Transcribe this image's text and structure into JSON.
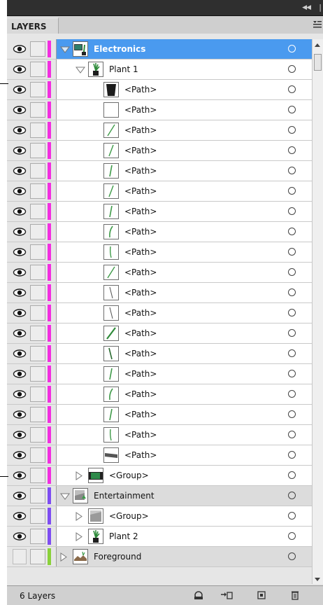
{
  "panel": {
    "tab_label": "LAYERS",
    "footer_count": "6 Layers"
  },
  "colors": {
    "magenta": "#f22ee0",
    "purple": "#7e4df2",
    "green": "#8ad13a",
    "selection": "#4a9aef"
  },
  "rows": [
    {
      "label": "Electronics",
      "depth": 0,
      "kind": "layer",
      "expanded": true,
      "selected": true,
      "color": "magenta",
      "visible": true,
      "thumb": "electronics"
    },
    {
      "label": "Plant 1",
      "depth": 1,
      "kind": "group",
      "expanded": true,
      "color": "magenta",
      "visible": true,
      "thumb": "plant"
    },
    {
      "label": "<Path>",
      "depth": 2,
      "kind": "path",
      "color": "magenta",
      "visible": true,
      "thumb": "pot"
    },
    {
      "label": "<Path>",
      "depth": 2,
      "kind": "path",
      "color": "magenta",
      "visible": true,
      "thumb": "blank"
    },
    {
      "label": "<Path>",
      "depth": 2,
      "kind": "path",
      "color": "magenta",
      "visible": true,
      "thumb": "leaf1"
    },
    {
      "label": "<Path>",
      "depth": 2,
      "kind": "path",
      "color": "magenta",
      "visible": true,
      "thumb": "leaf2"
    },
    {
      "label": "<Path>",
      "depth": 2,
      "kind": "path",
      "color": "magenta",
      "visible": true,
      "thumb": "leaf3"
    },
    {
      "label": "<Path>",
      "depth": 2,
      "kind": "path",
      "color": "magenta",
      "visible": true,
      "thumb": "leaf2"
    },
    {
      "label": "<Path>",
      "depth": 2,
      "kind": "path",
      "color": "magenta",
      "visible": true,
      "thumb": "leaf3"
    },
    {
      "label": "<Path>",
      "depth": 2,
      "kind": "path",
      "color": "magenta",
      "visible": true,
      "thumb": "leaf4"
    },
    {
      "label": "<Path>",
      "depth": 2,
      "kind": "path",
      "color": "magenta",
      "visible": true,
      "thumb": "leaf5"
    },
    {
      "label": "<Path>",
      "depth": 2,
      "kind": "path",
      "color": "magenta",
      "visible": true,
      "thumb": "leaf1"
    },
    {
      "label": "<Path>",
      "depth": 2,
      "kind": "path",
      "color": "magenta",
      "visible": true,
      "thumb": "leaf6"
    },
    {
      "label": "<Path>",
      "depth": 2,
      "kind": "path",
      "color": "magenta",
      "visible": true,
      "thumb": "leaf6"
    },
    {
      "label": "<Path>",
      "depth": 2,
      "kind": "path",
      "color": "magenta",
      "visible": true,
      "thumb": "leaf7"
    },
    {
      "label": "<Path>",
      "depth": 2,
      "kind": "path",
      "color": "magenta",
      "visible": true,
      "thumb": "leaf8"
    },
    {
      "label": "<Path>",
      "depth": 2,
      "kind": "path",
      "color": "magenta",
      "visible": true,
      "thumb": "leaf3"
    },
    {
      "label": "<Path>",
      "depth": 2,
      "kind": "path",
      "color": "magenta",
      "visible": true,
      "thumb": "leaf4"
    },
    {
      "label": "<Path>",
      "depth": 2,
      "kind": "path",
      "color": "magenta",
      "visible": true,
      "thumb": "leaf3"
    },
    {
      "label": "<Path>",
      "depth": 2,
      "kind": "path",
      "color": "magenta",
      "visible": true,
      "thumb": "leaf5"
    },
    {
      "label": "<Path>",
      "depth": 2,
      "kind": "path",
      "color": "magenta",
      "visible": true,
      "thumb": "shelf"
    },
    {
      "label": "<Group>",
      "depth": 1,
      "kind": "group",
      "expanded": false,
      "color": "magenta",
      "visible": true,
      "thumb": "tv"
    },
    {
      "label": "Entertainment",
      "depth": 0,
      "kind": "layer",
      "expanded": true,
      "color": "purple",
      "visible": true,
      "thumb": "entertain"
    },
    {
      "label": "<Group>",
      "depth": 1,
      "kind": "group",
      "expanded": false,
      "color": "purple",
      "visible": true,
      "thumb": "grp2"
    },
    {
      "label": "Plant 2",
      "depth": 1,
      "kind": "group",
      "expanded": false,
      "color": "purple",
      "visible": true,
      "thumb": "plant"
    },
    {
      "label": "Foreground",
      "depth": 0,
      "kind": "layer",
      "expanded": false,
      "color": "green",
      "visible": false,
      "thumb": "fore"
    }
  ],
  "icons": {
    "collapse": "double-chevron-left-icon",
    "close": "close-icon",
    "menu": "panel-menu-icon",
    "eye": "eye-icon",
    "footer": [
      "make-clipping-mask-icon",
      "create-sublayer-icon",
      "new-layer-icon",
      "delete-icon"
    ]
  }
}
